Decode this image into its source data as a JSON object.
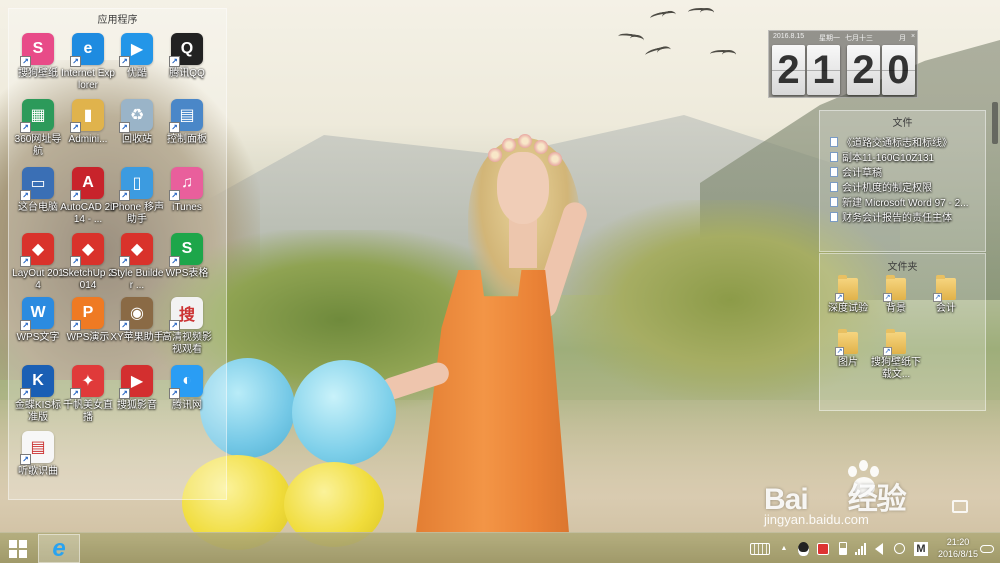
{
  "desktop": {
    "app_panel": {
      "title": "应用程序",
      "apps": [
        {
          "label": "搜狗壁纸",
          "icon": "sogou-wallpaper-icon",
          "color": "#e84b88"
        },
        {
          "label": "Internet Explorer",
          "icon": "internet-explorer-icon",
          "color": "#1e8be0"
        },
        {
          "label": "优酷",
          "icon": "youku-icon",
          "color": "#2396e8"
        },
        {
          "label": "腾讯QQ",
          "icon": "qq-penguin-icon",
          "color": "#222222"
        },
        {
          "label": "360网址导航",
          "icon": "360-navigation-icon",
          "color": "#2c9a5a"
        },
        {
          "label": "Admini...",
          "icon": "user-folder-icon",
          "color": "#e0b34c"
        },
        {
          "label": "回收站",
          "icon": "recycle-bin-icon",
          "color": "#9ab4c8"
        },
        {
          "label": "控制面板",
          "icon": "control-panel-icon",
          "color": "#4a87c8"
        },
        {
          "label": "这台电脑",
          "icon": "computer-icon",
          "color": "#3a6fb5"
        },
        {
          "label": "AutoCAD 2014 - ...",
          "icon": "autocad-icon",
          "color": "#c8232b"
        },
        {
          "label": "iPhone 移声助手",
          "icon": "iphone-assistant-icon",
          "color": "#3c9be0"
        },
        {
          "label": "iTunes",
          "icon": "itunes-icon",
          "color": "#e95f9c"
        },
        {
          "label": "LayOut 2014",
          "icon": "layout-icon",
          "color": "#d9322b"
        },
        {
          "label": "SketchUp 2014",
          "icon": "sketchup-icon",
          "color": "#d9322b"
        },
        {
          "label": "Style Builder ...",
          "icon": "style-builder-icon",
          "color": "#d9322b"
        },
        {
          "label": "WPS表格",
          "icon": "wps-spreadsheet-icon",
          "color": "#1da64a"
        },
        {
          "label": "WPS文字",
          "icon": "wps-writer-icon",
          "color": "#2b8be0"
        },
        {
          "label": "WPS演示",
          "icon": "wps-presentation-icon",
          "color": "#ef7a23"
        },
        {
          "label": "XY苹果助手",
          "icon": "xy-assistant-icon",
          "color": "#8a6a45"
        },
        {
          "label": "高清视频影视观看",
          "icon": "sohu-video-icon",
          "color": "#f2f2f2"
        },
        {
          "label": "金蝶KIS标准版",
          "icon": "kingdee-kis-icon",
          "color": "#1a5fb4"
        },
        {
          "label": "千帆美女直播",
          "icon": "qianfan-live-icon",
          "color": "#e03a3a"
        },
        {
          "label": "搜狐影音",
          "icon": "sohu-player-icon",
          "color": "#d32f2f"
        },
        {
          "label": "腾讯网",
          "icon": "tencent-news-icon",
          "color": "#2a9df4"
        },
        {
          "label": "听歌识曲",
          "icon": "document-file-icon",
          "color": "#f7f7f7"
        }
      ]
    },
    "clock_widget": {
      "date": "2016.8.15",
      "weekday": "星期一",
      "lunar": "七月十三",
      "month_label": "月",
      "close_symbol": "×",
      "hour_tens": "2",
      "hour_ones": "1",
      "min_tens": "2",
      "min_ones": "0"
    },
    "files_panel": {
      "title": "文件",
      "items": [
        "《道路交通标志和标线》",
        "副本11-160G10Z131",
        "会计草稿",
        "会计机度的制定权限",
        "新建 Microsoft Word 97 - 2...",
        "财务会计报告的责任主体"
      ]
    },
    "folders_panel": {
      "title": "文件夹",
      "items": [
        "深度试验",
        "背景",
        "会计",
        "图片",
        "搜狗壁纸下载文..."
      ]
    },
    "watermark": {
      "brand": "Bai",
      "brand_suffix": "经验",
      "url": "jingyan.baidu.com"
    }
  },
  "taskbar": {
    "pinned": [
      {
        "icon": "internet-explorer-icon"
      }
    ],
    "tray_icons": [
      "keyboard-icon",
      "tray-up-arrow-icon",
      "qq-tray-icon",
      "security-tray-icon",
      "battery-icon",
      "network-icon",
      "volume-icon",
      "ime-icon"
    ],
    "ime_label": "M",
    "up_arrow": "▲",
    "time": "21:20",
    "date": "2016/8/15"
  }
}
